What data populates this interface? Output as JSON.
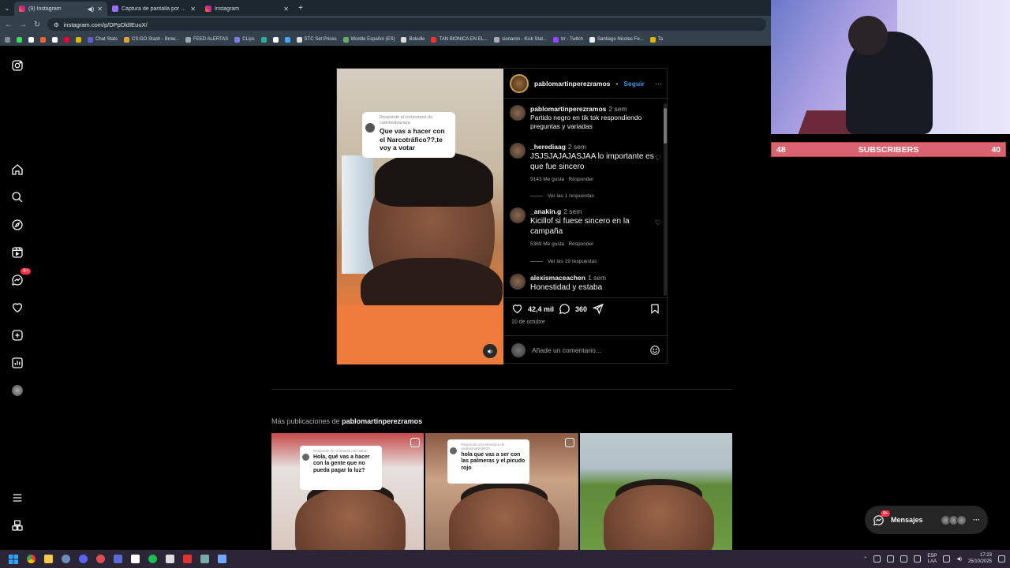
{
  "browser": {
    "tabs": [
      {
        "title": "(9) Instagram",
        "active": true
      },
      {
        "title": "Captura de pantalla por Lightshot",
        "active": false
      },
      {
        "title": "Instagram",
        "active": false
      }
    ],
    "new_tab": "+",
    "url": "instagram.com/p/DPpDldIEuuX/",
    "bookmarks": [
      "Chat Stats",
      "CS:GO Stash - Brow...",
      "FEED ALERTAS",
      "CLips",
      "STC Set Prices",
      "Wordle Español (ES)",
      "Boludle",
      "TAN BIONICA EN EL...",
      "sionaron - Kick Stat...",
      "trr - Twitch",
      "Santiago Nicolas Fe...",
      "Ta"
    ]
  },
  "sidebar": {
    "items": [
      {
        "icon": "instagram-logo-icon"
      },
      {
        "icon": "home-icon"
      },
      {
        "icon": "search-icon"
      },
      {
        "icon": "explore-icon"
      },
      {
        "icon": "reels-icon"
      },
      {
        "icon": "messages-icon",
        "badge": "9+"
      },
      {
        "icon": "notifications-icon"
      },
      {
        "icon": "create-icon"
      },
      {
        "icon": "dashboard-icon"
      },
      {
        "icon": "profile-avatar"
      },
      {
        "icon": "more-menu-icon"
      },
      {
        "icon": "also-from-meta-icon"
      }
    ]
  },
  "post": {
    "username": "pablomartinperezramos",
    "dot": "•",
    "follow": "Seguir",
    "more": "···",
    "video_bubble": {
      "small": "Responde al comentario de camilosilvaviara",
      "question": "Que vas a hacer con el Narcotráfico??,te voy a votar"
    },
    "comments": [
      {
        "user": "pablomartinperezramos",
        "time": "2 sem",
        "text": "Partido negro en tik tok respondiendo preguntas y variadas"
      },
      {
        "user": "_herediaag",
        "time": "2 sem",
        "text": "JSJSJAJAJASJAA lo importante es que fue sincero",
        "likes": "9143 Me gusta",
        "reply": "Responder",
        "replies": "Ver las 1 respuestas"
      },
      {
        "user": "_anakin.g",
        "time": "2 sem",
        "text": "Kicillof si fuese sincero en la campaña",
        "likes": "5369 Me gusta",
        "reply": "Responder",
        "replies": "Ver las 19 respuestas"
      },
      {
        "user": "alexismaceachen",
        "time": "1 sem",
        "text": "Honestidad y estaba"
      }
    ],
    "likes": "42,4 mil",
    "comments_count": "360",
    "date": "10 de octubre",
    "add_comment_placeholder": "Añade un comentario..."
  },
  "more_posts": {
    "prefix": "Más publicaciones de",
    "user": "pablomartinperezramos",
    "thumbs": [
      {
        "small": "Responde al comentario de tasbur",
        "question": "Hola, qué vas a hacer con la gente que no pueda pagar la luz?"
      },
      {
        "small": "Responde al comentario de andresmartin5403",
        "question": "hola que vas a ser con las palmeras y el.picudo rojo"
      },
      {
        "small": "",
        "question": ""
      }
    ]
  },
  "messages": {
    "label": "Mensajes",
    "badge": "9+"
  },
  "overlay": {
    "sub_left": "48",
    "sub_label": "SUBSCRIBERS",
    "sub_right": "40"
  },
  "taskbar": {
    "lang": "ESP",
    "lang2": "LAA",
    "time": "17:23",
    "date": "25/10/2025"
  }
}
